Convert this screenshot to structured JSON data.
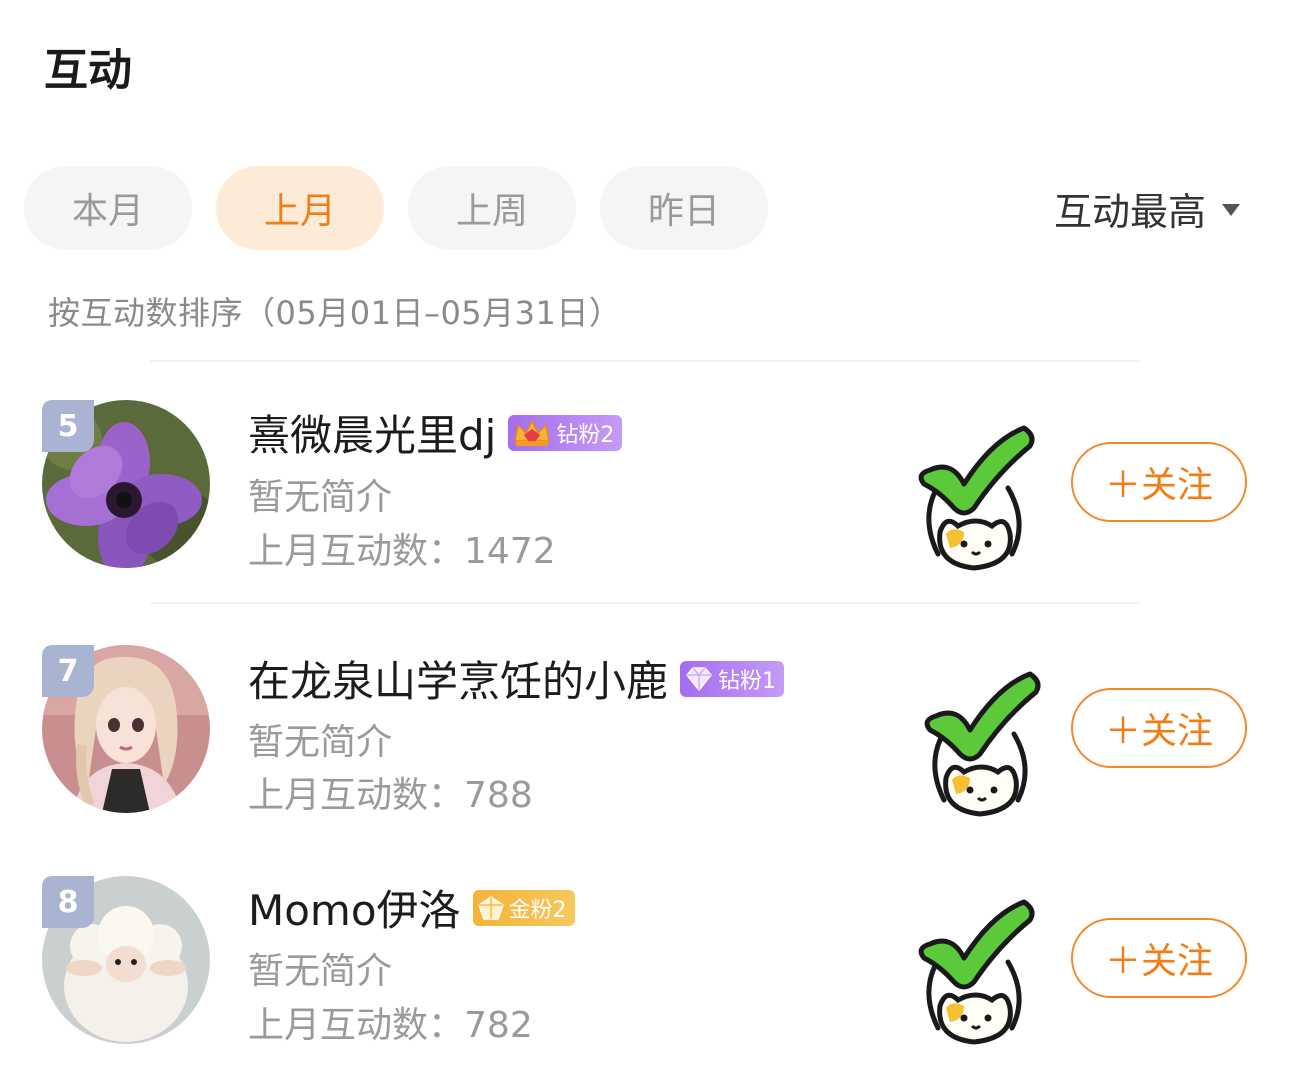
{
  "header": {
    "title": "互动"
  },
  "tabs": [
    {
      "label": "本月",
      "active": false
    },
    {
      "label": "上月",
      "active": true
    },
    {
      "label": "上周",
      "active": false
    },
    {
      "label": "昨日",
      "active": false
    }
  ],
  "sort": {
    "selected": "互动最高",
    "icon": "caret-down-icon"
  },
  "hint": "按互动数排序（05月01日–05月31日）",
  "users": [
    {
      "rank": "5",
      "name": "熹微晨光里dj",
      "badge": {
        "label": "钻粉2",
        "icon": "crown-icon"
      },
      "bio": "暂无简介",
      "count_label": "上月互动数：",
      "count": "1472",
      "follow": "＋关注"
    },
    {
      "rank": "7",
      "name": "在龙泉山学烹饪的小鹿",
      "badge": {
        "label": "钻粉1",
        "icon": "diamond-icon"
      },
      "bio": "暂无简介",
      "count_label": "上月互动数：",
      "count": "788",
      "follow": "＋关注"
    },
    {
      "rank": "8",
      "name": "Momo伊洛",
      "badge": {
        "label": "金粉2",
        "icon": "gold-gem-icon"
      },
      "bio": "暂无简介",
      "count_label": "上月互动数：",
      "count": "782",
      "follow": "＋关注"
    }
  ],
  "colors": {
    "accent": "#f07e16",
    "tab_active_bg": "#fdebd8",
    "rank_badge": "#a9b4d3",
    "check_green": "#5cc93a"
  }
}
